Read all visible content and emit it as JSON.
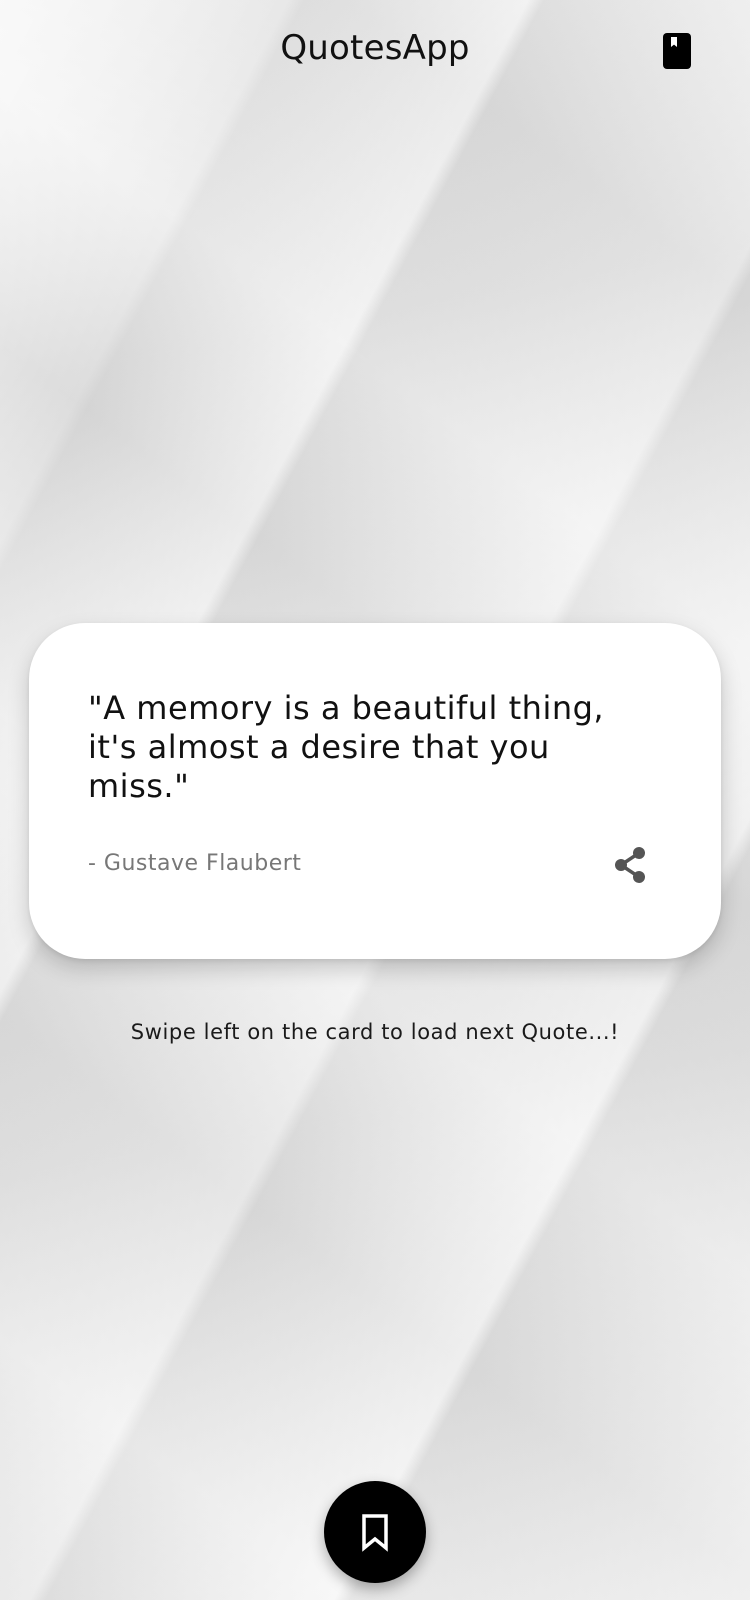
{
  "app_bar": {
    "title": "QuotesApp",
    "action_icon": "book-icon"
  },
  "quote_card": {
    "text": "\"A memory is a beautiful thing, it's almost a desire that you miss.\"",
    "author": "- Gustave Flaubert",
    "share_icon": "share-icon",
    "background": "#ffffff"
  },
  "hint": {
    "text": "Swipe left on the card to load next Quote...!"
  },
  "fab": {
    "icon": "bookmark-icon",
    "background": "#000000"
  }
}
